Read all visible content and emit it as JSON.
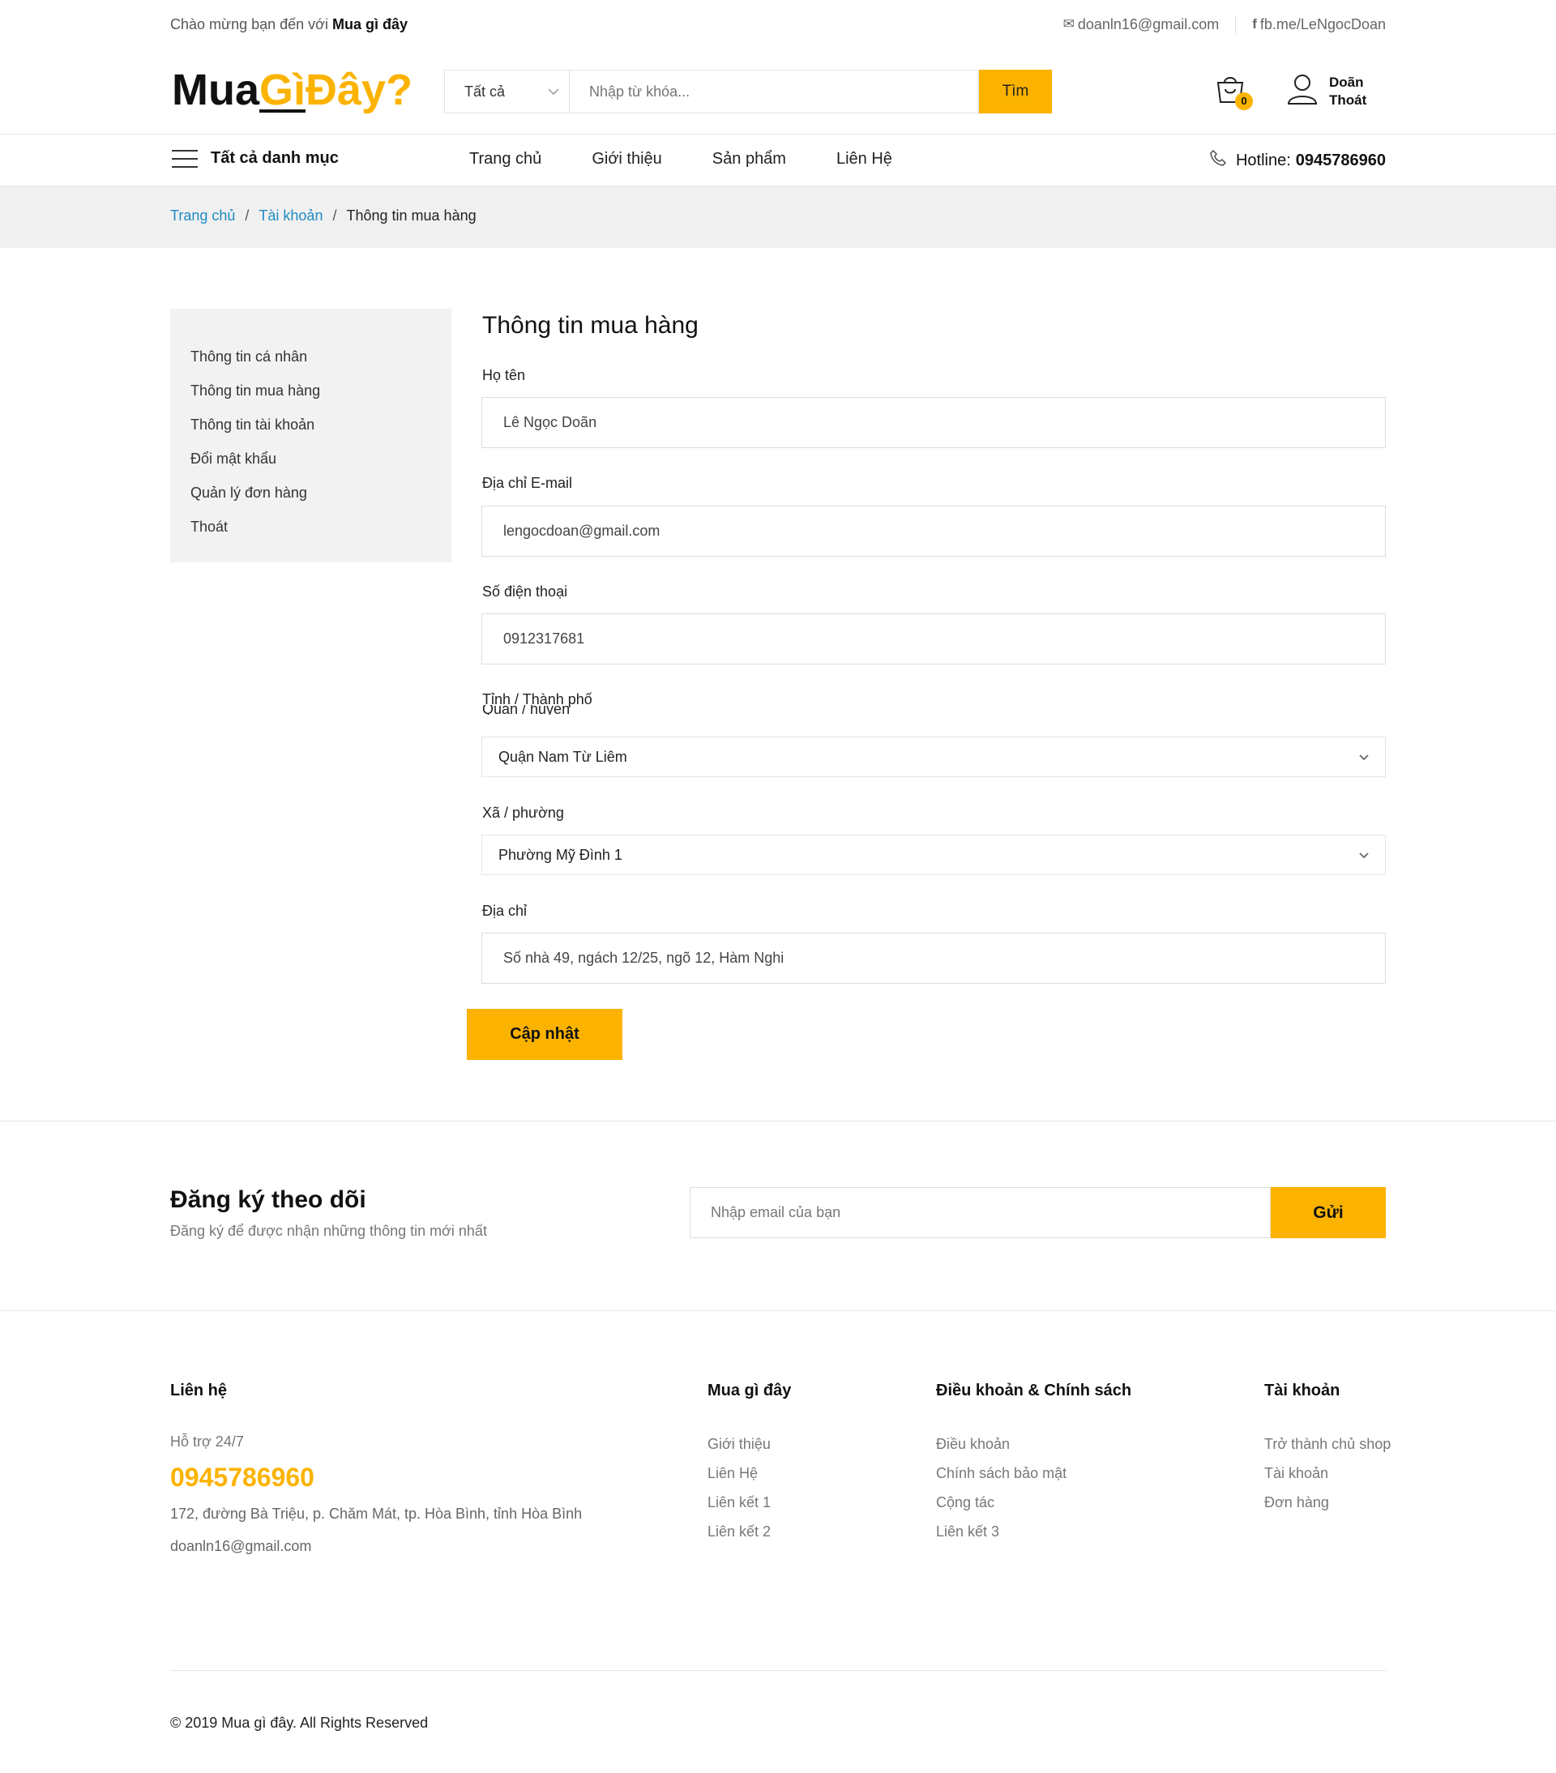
{
  "topbar": {
    "welcome_prefix": "Chào mừng bạn đến với",
    "welcome_brand": "Mua gì đây",
    "email": "doanln16@gmail.com",
    "facebook": "fb.me/LeNgocDoan"
  },
  "logo": {
    "part1": "Mua",
    "part2": "Gì",
    "part3": "Đây?"
  },
  "search": {
    "category": "Tất cả",
    "placeholder": "Nhập từ khóa...",
    "button": "Tìm"
  },
  "cart": {
    "count": "0"
  },
  "user": {
    "name": "Doãn",
    "logout": "Thoát"
  },
  "nav": {
    "all_categories": "Tất cả danh mục",
    "items": [
      "Trang chủ",
      "Giới thiệu",
      "Sản phẩm",
      "Liên Hệ"
    ],
    "hotline_label": "Hotline:",
    "hotline_number": "0945786960"
  },
  "breadcrumb": {
    "home": "Trang chủ",
    "account": "Tài khoản",
    "current": "Thông tin mua hàng"
  },
  "sidebar": {
    "items": [
      "Thông tin cá nhân",
      "Thông tin mua hàng",
      "Thông tin tài khoản",
      "Đổi mật khẩu",
      "Quản lý đơn hàng",
      "Thoát"
    ]
  },
  "form": {
    "title": "Thông tin mua hàng",
    "name_label": "Họ tên",
    "name_value": "Lê Ngọc Doãn",
    "email_label": "Địa chỉ E-mail",
    "email_value": "lengocdoan@gmail.com",
    "phone_label": "Số điện thoại",
    "phone_value": "0912317681",
    "city_label": "Tỉnh / Thành phố",
    "district_label": "Quận / huyện",
    "district_value": "Quận Nam Từ Liêm",
    "ward_label": "Xã / phường",
    "ward_value": "Phường Mỹ Đình 1",
    "address_label": "Địa chỉ",
    "address_value": "Số nhà 49, ngách 12/25, ngõ 12, Hàm Nghi",
    "submit": "Cập nhật"
  },
  "subscribe": {
    "title": "Đăng ký theo dõi",
    "description": "Đăng ký để được nhận những thông tin mới nhất",
    "placeholder": "Nhập email của bạn",
    "button": "Gửi"
  },
  "footer": {
    "contact": {
      "heading": "Liên hệ",
      "support": "Hỗ trợ 24/7",
      "phone": "0945786960",
      "address": "172, đường Bà Triệu, p. Chăm Mát, tp. Hòa Bình, tỉnh Hòa Bình",
      "email": "doanln16@gmail.com"
    },
    "col1": {
      "heading": "Mua gì đây",
      "items": [
        "Giới thiệu",
        "Liên Hệ",
        "Liên kết 1",
        "Liên kết 2"
      ]
    },
    "col2": {
      "heading": "Điều khoản & Chính sách",
      "items": [
        "Điều khoản",
        "Chính sách bảo mật",
        "Cộng tác",
        "Liên kết 3"
      ]
    },
    "col3": {
      "heading": "Tài khoản",
      "items": [
        "Trở thành chủ shop",
        "Tài khoản",
        "Đơn hàng"
      ]
    },
    "copyright": "© 2019 Mua gì đây. All Rights Reserved"
  },
  "colors": {
    "accent": "#fcb300",
    "link": "#1e8bc3",
    "panel": "#f2f2f2"
  }
}
